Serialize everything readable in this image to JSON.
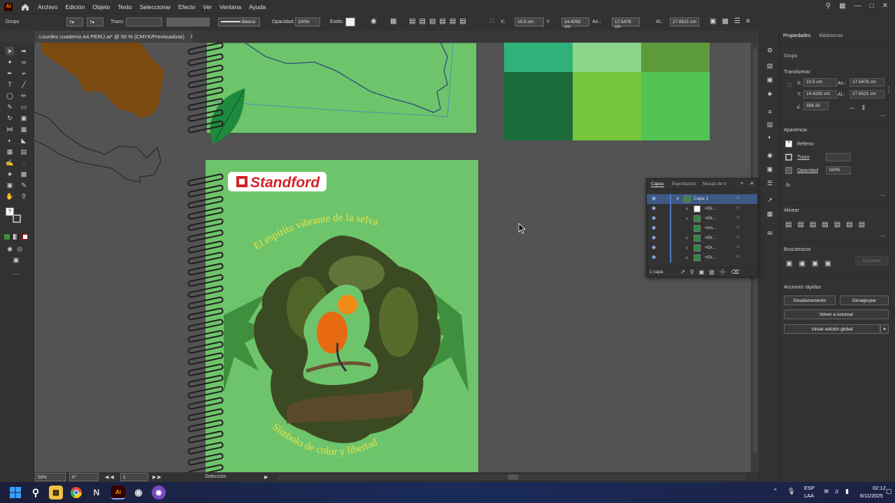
{
  "menubar": {
    "app_logo": "Ai",
    "items": [
      "Archivo",
      "Edición",
      "Objeto",
      "Texto",
      "Seleccionar",
      "Efecto",
      "Ver",
      "Ventana",
      "Ayuda"
    ]
  },
  "controlbar": {
    "selection_label": "Grupo",
    "stroke_label": "Trazo:",
    "stroke_style": "Básico",
    "opacity_label": "Opacidad:",
    "opacity_value": "100%",
    "style_label": "Estilo:",
    "x_label": "X:",
    "x_value": "10.5 cm",
    "y_label": "Y:",
    "y_value": "14.4292 cm",
    "w_label": "An.:",
    "w_value": "17.5478 cm",
    "h_label": "Al.:",
    "h_value": "27.6521 cm"
  },
  "document": {
    "tab_title": "Lourdes cuaderno A4 PERÚ.ai* @ 50 % (CMYK/Previsualizar)"
  },
  "canvas": {
    "brand_text": "Standford",
    "arc_text_top": "El espíritu vibrante de la selva",
    "arc_text_bottom": "Símbolo de color y libertad",
    "swatch_colors": [
      "#2fb27a",
      "#8ad68a",
      "#5c9a3c",
      "#1b6b3a",
      "#76c73d",
      "#52c456"
    ]
  },
  "statusbar": {
    "zoom": "50%",
    "rotation": "0°",
    "artboard_number": "1",
    "mode": "Selección"
  },
  "layers_panel": {
    "tabs": [
      "Capas",
      "Exportación",
      "Mesas de tr"
    ],
    "rows": [
      {
        "name": "Capa 1"
      },
      {
        "name": "<Gr..."
      },
      {
        "name": "<Gr..."
      },
      {
        "name": "<Im..."
      },
      {
        "name": "<Gr..."
      },
      {
        "name": "<Gr..."
      },
      {
        "name": "<Gr..."
      }
    ],
    "footer": "1 capa"
  },
  "properties": {
    "tabs": [
      "Propiedades",
      "Bibliotecas"
    ],
    "selection_type": "Grupo",
    "transform_title": "Transformar",
    "x_label": "X:",
    "x_value": "10.5 cm",
    "y_label": "Y:",
    "y_value": "14.4292 cm",
    "w_label": "An.:",
    "w_value": "17.5478 cm",
    "h_label": "Al.:",
    "h_value": "27.6521 cm",
    "angle_value": "356.32",
    "appearance_title": "Apariencia",
    "fill_label": "Relleno",
    "stroke_label": "Trazo",
    "opacity_label": "Opacidad",
    "opacity_value": "100%",
    "fx_label": "fx.",
    "align_title": "Alinear",
    "pathfinder_title": "Buscatrazos",
    "expand_label": "Expandir",
    "quick_actions_title": "Acciones rápidas",
    "offset_button": "Desplazamiento",
    "ungroup_button": "Desagrupar",
    "recolor_button": "Volver a colorear",
    "global_edit_button": "Iniciar edición global"
  },
  "taskbar": {
    "language": "ESP",
    "region": "LAA",
    "time": "02:12",
    "date": "6/11/2025"
  }
}
